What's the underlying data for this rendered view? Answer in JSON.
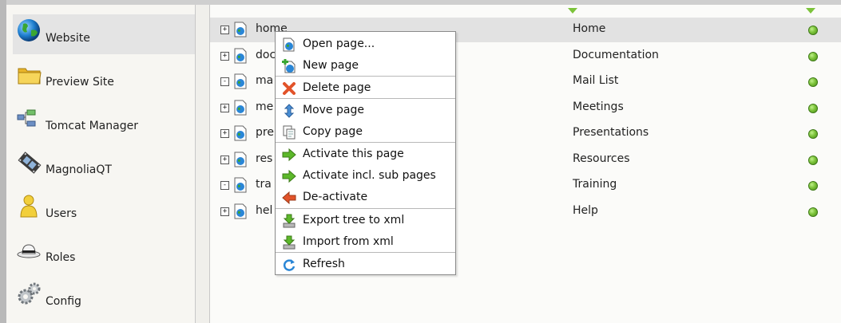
{
  "sidebar": {
    "items": [
      {
        "label": "Website",
        "icon": "globe-icon"
      },
      {
        "label": "Preview Site",
        "icon": "folder-icon"
      },
      {
        "label": "Tomcat Manager",
        "icon": "network-icon"
      },
      {
        "label": "MagnoliaQT",
        "icon": "film-icon"
      },
      {
        "label": "Users",
        "icon": "user-icon"
      },
      {
        "label": "Roles",
        "icon": "hat-icon"
      },
      {
        "label": "Config",
        "icon": "gears-icon"
      }
    ]
  },
  "tree": {
    "rows": [
      {
        "expander": "+",
        "name": "home",
        "title": "Home",
        "status": "active"
      },
      {
        "expander": "+",
        "name": "doc",
        "title": "Documentation",
        "status": "active"
      },
      {
        "expander": "-",
        "name": "ma",
        "title": "Mail List",
        "status": "active"
      },
      {
        "expander": "+",
        "name": "me",
        "title": "Meetings",
        "status": "active"
      },
      {
        "expander": "+",
        "name": "pre",
        "title": "Presentations",
        "status": "active"
      },
      {
        "expander": "+",
        "name": "res",
        "title": "Resources",
        "status": "active"
      },
      {
        "expander": "-",
        "name": "tra",
        "title": "Training",
        "status": "active"
      },
      {
        "expander": "+",
        "name": "hel",
        "title": "Help",
        "status": "active"
      }
    ]
  },
  "context_menu": {
    "items": [
      {
        "label": "Open page...",
        "icon": "open-page-icon"
      },
      {
        "label": "New page",
        "icon": "new-page-icon"
      },
      {
        "label": "Delete page",
        "icon": "delete-icon"
      },
      {
        "label": "Move page",
        "icon": "move-icon"
      },
      {
        "label": "Copy page",
        "icon": "copy-icon"
      },
      {
        "label": "Activate this page",
        "icon": "activate-icon"
      },
      {
        "label": "Activate incl. sub pages",
        "icon": "activate-sub-icon"
      },
      {
        "label": "De-activate",
        "icon": "deactivate-icon"
      },
      {
        "label": "Export tree to xml",
        "icon": "export-icon"
      },
      {
        "label": "Import from xml",
        "icon": "import-icon"
      },
      {
        "label": "Refresh",
        "icon": "refresh-icon"
      }
    ]
  },
  "colors": {
    "status_active": "#7cc33a",
    "selected_row": "#e2e2e2",
    "activate_green": "#5cb82a",
    "deactivate_red": "#e2532a"
  }
}
